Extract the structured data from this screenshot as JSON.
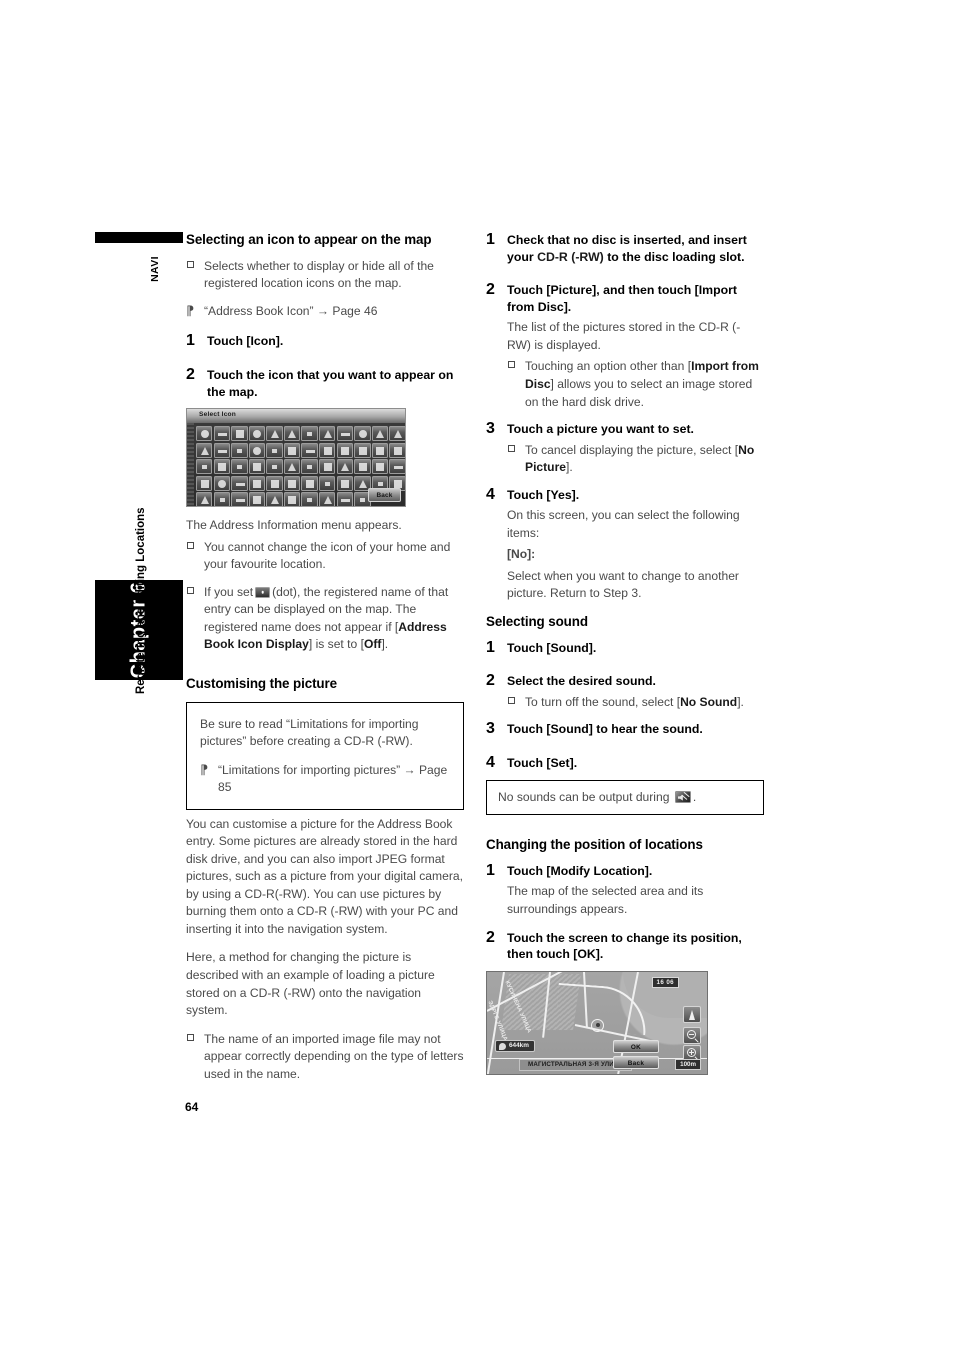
{
  "page": {
    "number": "64",
    "rail": {
      "navi_label": "NAVI",
      "chapter_label": "Chapter 6",
      "section_label": "Registering and Editing Locations"
    }
  },
  "left_column": {
    "heading": "Selecting an icon to appear on the map",
    "note1": "Selects whether to display or hide all of the registered location icons on the map.",
    "ref1": "“Address Book Icon” → Page 46",
    "step1_num": "1",
    "step1_text": "Touch [Icon].",
    "step2_num": "2",
    "step2_text": "Touch the icon that you want to appear on the map.",
    "screenshot": {
      "title": "Select Icon",
      "back_button": "Back",
      "rows": 5,
      "columns": 12
    },
    "after_shot": "The Address Information menu appears.",
    "note2": "You cannot change the icon of your home and your favourite location.",
    "note3_a": "If you set",
    "note3_icon": "dot-icon",
    "note3_b": "(dot), the registered name of that entry can be displayed on the map. The registered name does not appear if [",
    "note3_bold1": "Address Book Icon Display",
    "note3_c": "] is set to [",
    "note3_bold2": "Off",
    "note3_d": "].",
    "heading2": "Customising the picture",
    "callout_text": "Be sure to read “Limitations for importing pictures” before creating a CD-R (-RW).",
    "callout_ref": "“Limitations for importing pictures” → Page 85",
    "para1": "You can customise a picture for the Address Book entry. Some pictures are already stored in the hard disk drive, and you can also import JPEG format pictures, such as a picture from your digital camera, by using a CD-R(-RW). You can use pictures by burning them onto a CD-R (-RW) with your PC and inserting it into the navigation system.",
    "para2": "Here, a method for changing the picture is described with an example of loading a picture stored on a CD-R (-RW) onto the navigation system.",
    "note4": "The name of an imported image file may not appear correctly depending on the type of letters used in the name."
  },
  "right_column": {
    "step1_num": "1",
    "step1_a": "Check that no disc is inserted, and insert your ",
    "step1_bold": "CD-R (-RW)",
    "step1_b": " to the disc loading slot.",
    "step2_num": "2",
    "step2_text": "Touch [Picture], and then touch [Import from Disc].",
    "step2_body": "The list of the pictures stored in the CD-R (-RW) is displayed.",
    "step2_note_a": "Touching an option other than [",
    "step2_note_bold": "Import from Disc",
    "step2_note_b": "] allows you to select an image stored on the hard disk drive.",
    "step3_num": "3",
    "step3_text": "Touch a picture you want to set.",
    "step3_note_a": "To cancel displaying the picture, select [",
    "step3_note_bold": "No Picture",
    "step3_note_b": "].",
    "step4_num": "4",
    "step4_text": "Touch [Yes].",
    "step4_body": "On this screen, you can select the following items:",
    "step4_label": "[No]:",
    "step4_desc": "Select when you want to change to another picture. Return to Step 3.",
    "heading_sound": "Selecting sound",
    "s1_num": "1",
    "s1_text": "Touch [Sound].",
    "s2_num": "2",
    "s2_text": "Select the desired sound.",
    "s2_note_a": "To turn off the sound, select [",
    "s2_note_bold": "No Sound",
    "s2_note_b": "].",
    "s3_num": "3",
    "s3_text": "Touch [Sound] to hear the sound.",
    "s4_num": "4",
    "s4_text": "Touch [Set].",
    "sound_callout_a": "No sounds can be output during",
    "sound_callout_icon": "mute-icon",
    "sound_callout_b": ".",
    "heading_position": "Changing the position of locations",
    "p1_num": "1",
    "p1_text": "Touch [Modify Location].",
    "p1_body": "The map of the selected area and its surroundings appears.",
    "p2_num": "2",
    "p2_text": "Touch the screen to change its position, then touch [OK].",
    "map_screenshot": {
      "clock": "16 06",
      "distance": "644km",
      "street_label": "МАГИСТРАЛЬНАЯ 3-Я УЛИЦА",
      "street_v1": "КУСИНЕНА УЛИЦА",
      "street_v2": "ЭДРГЕ УЛИЦА",
      "ok_button": "OK",
      "back_button": "Back",
      "scale": "100m"
    }
  }
}
